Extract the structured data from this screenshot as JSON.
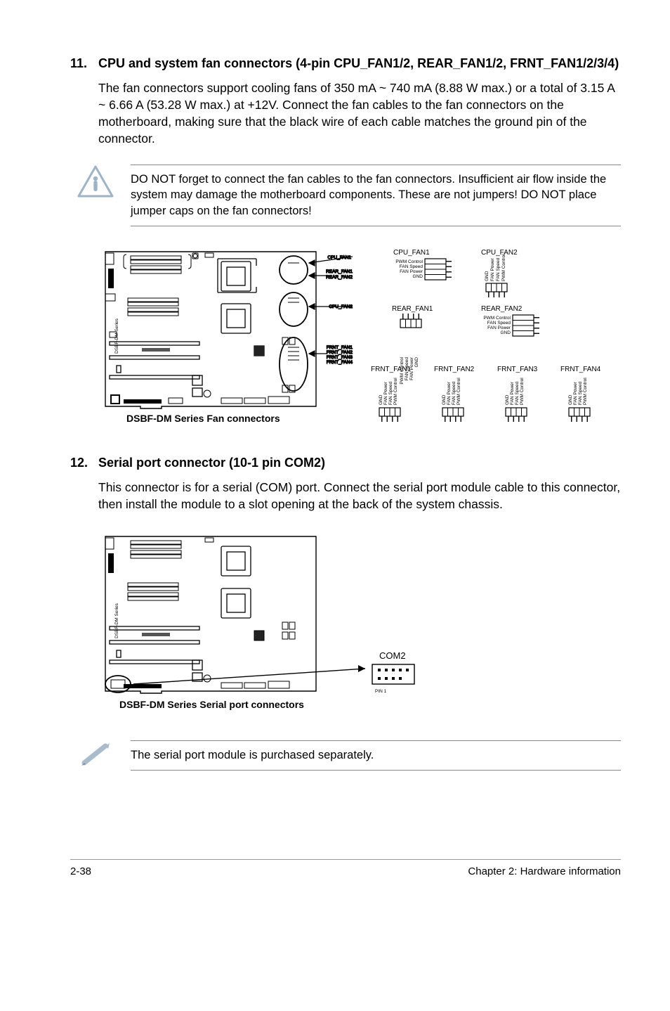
{
  "sections": {
    "s11": {
      "num": "11.",
      "title": "CPU and system fan connectors (4-pin CPU_FAN1/2, REAR_FAN1/2, FRNT_FAN1/2/3/4)",
      "body": "The fan connectors support cooling fans of 350 mA ~ 740 mA (8.88 W max.) or a total of 3.15 A ~ 6.66 A (53.28 W max.) at +12V. Connect the fan cables to the fan connectors on the motherboard, making sure that the black wire of each cable matches the ground pin of the connector.",
      "warning": "DO NOT forget to connect the fan cables to the fan connectors. Insufficient air flow inside the system may damage the motherboard components. These are not jumpers! DO NOT place jumper caps on the fan connectors!"
    },
    "s12": {
      "num": "12.",
      "title": "Serial port connector (10-1 pin COM2)",
      "body": "This connector is for a serial (COM) port. Connect the serial port module cable to this connector, then install the module to a slot opening at the back of the system chassis.",
      "note": "The serial port module is purchased separately."
    }
  },
  "diagrams": {
    "fan": {
      "caption": "DSBF-DM Series Fan connectors",
      "board_side_label": "DSBF-DM Series",
      "board_labels": [
        "CPU_FAN1",
        "REAR_FAN1",
        "REAR_FAN2",
        "CPU_FAN2",
        "FRNT_FAN1",
        "FRNT_FAN2",
        "FRNT_FAN3",
        "FRNT_FAN4"
      ],
      "conn": {
        "cpu_fan1": {
          "name": "CPU_FAN1",
          "pins": [
            "PWM Control",
            "FAN Speed",
            "FAN Power",
            "GND"
          ]
        },
        "cpu_fan2": {
          "name": "CPU_FAN2",
          "pins": [
            "GND",
            "FAN Power",
            "FAN Speed",
            "PWM Control"
          ]
        },
        "rear_fan1": {
          "name": "REAR_FAN1",
          "pins": [
            "PWM Control",
            "FAN Speed",
            "FAN Power",
            "GND"
          ]
        },
        "rear_fan2": {
          "name": "REAR_FAN2",
          "pins": [
            "PWM Control",
            "FAN Speed",
            "FAN Power",
            "GND"
          ]
        },
        "frnt_fan1": {
          "name": "FRNT_FAN1",
          "pins": [
            "GND",
            "FAN Power",
            "FAN Speed",
            "PWM Control"
          ]
        },
        "frnt_fan2": {
          "name": "FRNT_FAN2",
          "pins": [
            "GND",
            "FAN Power",
            "FAN Speed",
            "PWM Control"
          ]
        },
        "frnt_fan3": {
          "name": "FRNT_FAN3",
          "pins": [
            "GND",
            "FAN Power",
            "FAN Speed",
            "PWM Control"
          ]
        },
        "frnt_fan4": {
          "name": "FRNT_FAN4",
          "pins": [
            "GND",
            "FAN Power",
            "FAN Speed",
            "PWM Control"
          ]
        }
      }
    },
    "serial": {
      "caption": "DSBF-DM Series Serial port connectors",
      "board_side_label": "DSBF-DM Series",
      "conn_label": "COM2",
      "pin_label": "PIN 1"
    }
  },
  "footer": {
    "left": "2-38",
    "right": "Chapter 2: Hardware information"
  }
}
